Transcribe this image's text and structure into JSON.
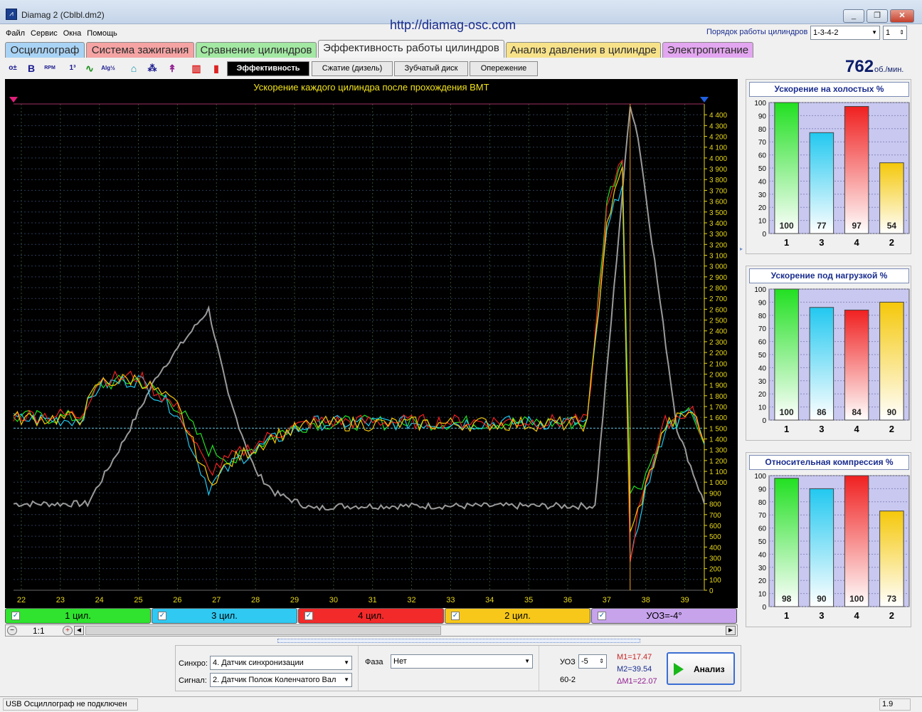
{
  "window": {
    "title": "Diamag 2 (Cblbl.dm2)",
    "url": "http://diamag-osc.com",
    "controls": [
      "_",
      "❐",
      "✕"
    ]
  },
  "menu": [
    "Файл",
    "Сервис",
    "Окна",
    "Помощь"
  ],
  "firing_order": {
    "label": "Порядок работы цилиндров",
    "value": "1-3-4-2",
    "cylinder_value": "1"
  },
  "tabs": [
    {
      "label": "Осциллограф",
      "color": "#a9d3f5"
    },
    {
      "label": "Система зажигания",
      "color": "#f5a3a3"
    },
    {
      "label": "Сравнение цилиндров",
      "color": "#a3e8a3"
    },
    {
      "label": "Эффективность работы цилиндров",
      "color": "#f4f4f4",
      "active": true
    },
    {
      "label": "Анализ давления в цилиндре",
      "color": "#f7e28a"
    },
    {
      "label": "Электропитание",
      "color": "#e3a6f0"
    }
  ],
  "toolbar": {
    "icons": [
      "o±",
      "B",
      "RPM",
      "1³",
      "∿",
      "Alg½",
      "⌂",
      "⁂",
      "↟",
      "▥",
      "▮"
    ],
    "icon_names": [
      "zero-offset-icon",
      "bold-icon",
      "rpm-icon",
      "scale-icon",
      "wave-icon",
      "algorithm-icon",
      "sensor-icon",
      "counter-icon",
      "filter-icon",
      "bars-chart-icon",
      "bar-icon"
    ],
    "subtabs": [
      "Эффективность",
      "Сжатие (дизель)",
      "Зубчатый диск",
      "Опережение"
    ]
  },
  "rpm": {
    "value": "762",
    "unit": "об./мин."
  },
  "scope": {
    "title": "Ускорение каждого цилиндра после прохождения ВМТ",
    "bg_color": "#000000"
  },
  "chart_data": [
    {
      "type": "line",
      "title": "Ускорение каждого цилиндра после прохождения ВМТ",
      "xlabel": "",
      "ylabel": "",
      "xlim": [
        21.8,
        39.5
      ],
      "ylim": [
        0,
        4500
      ],
      "x_ticks": [
        "22",
        "23",
        "24",
        "25",
        "26",
        "27",
        "28",
        "29",
        "30",
        "31",
        "32",
        "33",
        "34",
        "35",
        "36",
        "37",
        "38",
        "39"
      ],
      "y_ticks": [
        "0",
        "100",
        "200",
        "300",
        "400",
        "500",
        "600",
        "700",
        "800",
        "900",
        "1 000",
        "1 100",
        "1 200",
        "1 300",
        "1 400",
        "1 500",
        "1 600",
        "1 700",
        "1 800",
        "1 900",
        "2 000",
        "2 100",
        "2 200",
        "2 300",
        "2 400",
        "2 500",
        "2 600",
        "2 700",
        "2 800",
        "2 900",
        "3 000",
        "3 100",
        "3 200",
        "3 300",
        "3 400",
        "3 500",
        "3 600",
        "3 700",
        "3 800",
        "3 900",
        "4 000",
        "4 100",
        "4 200",
        "4 300",
        "4 400"
      ],
      "series": [
        {
          "name": "1 цил.",
          "color": "#22e022",
          "x": [
            21.8,
            23.5,
            24,
            25,
            26,
            26.8,
            27.5,
            28.5,
            29.5,
            31,
            33,
            35,
            36.5,
            37,
            37.4,
            37.6,
            37.9,
            38.5,
            39.2,
            39.5
          ],
          "y": [
            1600,
            1600,
            1900,
            1950,
            1700,
            1300,
            1200,
            1450,
            1550,
            1550,
            1550,
            1550,
            1550,
            3600,
            4000,
            900,
            1000,
            1500,
            1650,
            1350
          ]
        },
        {
          "name": "3 цил.",
          "color": "#22c8f0",
          "x": [
            21.8,
            23.5,
            24,
            25,
            26,
            26.8,
            27.5,
            28.5,
            29.5,
            31,
            33,
            35,
            36.5,
            37,
            37.4,
            37.6,
            37.9,
            38.5,
            39.2,
            39.5
          ],
          "y": [
            1580,
            1580,
            1900,
            1950,
            1650,
            950,
            1200,
            1400,
            1550,
            1550,
            1550,
            1550,
            1550,
            3300,
            3800,
            200,
            800,
            1500,
            1650,
            1350
          ]
        },
        {
          "name": "4 цил.",
          "color": "#f02020",
          "x": [
            21.8,
            23.5,
            24,
            25,
            26,
            26.8,
            27.5,
            28.5,
            29.5,
            31,
            33,
            35,
            36.5,
            37,
            37.4,
            37.6,
            37.9,
            38.5,
            39.2,
            39.5
          ],
          "y": [
            1620,
            1620,
            1950,
            1980,
            1680,
            1100,
            1250,
            1450,
            1560,
            1560,
            1560,
            1560,
            1560,
            3500,
            4000,
            300,
            900,
            1550,
            1680,
            1380
          ]
        },
        {
          "name": "2 цил.",
          "color": "#f5c80a",
          "x": [
            21.8,
            23.5,
            24,
            25,
            26,
            26.8,
            27.5,
            28.5,
            29.5,
            31,
            33,
            35,
            36.5,
            37,
            37.4,
            37.6,
            37.9,
            38.5,
            39.2,
            39.5
          ],
          "y": [
            1590,
            1590,
            1920,
            1960,
            1700,
            1000,
            1220,
            1430,
            1540,
            1540,
            1540,
            1540,
            1540,
            3400,
            3900,
            500,
            850,
            1520,
            1660,
            1360
          ]
        },
        {
          "name": "RPM",
          "color": "#9a9a9a",
          "x": [
            21.8,
            23.7,
            24.5,
            25.5,
            26.8,
            27.3,
            28,
            28.5,
            29.5,
            30,
            33,
            36.7,
            37.6,
            37.8,
            38.8,
            39.5
          ],
          "y": [
            800,
            800,
            1300,
            2000,
            2600,
            1800,
            1100,
            900,
            750,
            780,
            780,
            780,
            4500,
            4200,
            1500,
            800
          ]
        }
      ]
    },
    {
      "type": "bar",
      "title": "Ускорение на холостых %",
      "categories": [
        "1",
        "3",
        "4",
        "2"
      ],
      "values": [
        100,
        77,
        97,
        54
      ],
      "ylim": [
        0,
        100
      ],
      "y_ticks": [
        "0",
        "10",
        "20",
        "30",
        "40",
        "50",
        "60",
        "70",
        "80",
        "90",
        "100"
      ],
      "colors": [
        "#22e022",
        "#22c8f0",
        "#f02020",
        "#f5c80a"
      ]
    },
    {
      "type": "bar",
      "title": "Ускорение под нагрузкой %",
      "categories": [
        "1",
        "3",
        "4",
        "2"
      ],
      "values": [
        100,
        86,
        84,
        90
      ],
      "ylim": [
        0,
        100
      ],
      "y_ticks": [
        "0",
        "10",
        "20",
        "30",
        "40",
        "50",
        "60",
        "70",
        "80",
        "90",
        "100"
      ],
      "colors": [
        "#22e022",
        "#22c8f0",
        "#f02020",
        "#f5c80a"
      ]
    },
    {
      "type": "bar",
      "title": "Относительная компрессия %",
      "categories": [
        "1",
        "3",
        "4",
        "2"
      ],
      "values": [
        98,
        90,
        100,
        73
      ],
      "ylim": [
        0,
        100
      ],
      "y_ticks": [
        "0",
        "10",
        "20",
        "30",
        "40",
        "50",
        "60",
        "70",
        "80",
        "90",
        "100"
      ],
      "colors": [
        "#22e022",
        "#22c8f0",
        "#f02020",
        "#f5c80a"
      ]
    }
  ],
  "channels": [
    {
      "label": "1 цил.",
      "color": "#2fe32f",
      "check": "✓"
    },
    {
      "label": "3 цил.",
      "color": "#2fc9f2",
      "check": "✓"
    },
    {
      "label": "4 цил.",
      "color": "#f22a2a",
      "check": "✓"
    },
    {
      "label": "2 цил.",
      "color": "#f7c81a",
      "check": "✓"
    },
    {
      "label": "УОЗ=-4°",
      "color": "#c7a3ec",
      "check": "✓"
    }
  ],
  "scroll": {
    "zoom": "1:1",
    "minus": "−",
    "plus": "+",
    "left": "◄",
    "right": "►"
  },
  "controls": {
    "sync_label": "Синхро:",
    "sync_value": "4.  Датчик синхронизации",
    "signal_label": "Сигнал:",
    "signal_value": "2.  Датчик Полож Коленчатого Вал",
    "phase_label": "Фаза",
    "phase_value": "Нет",
    "uoz_label": "УОЗ",
    "uoz_value": "-5",
    "teeth": "60-2",
    "m1": "M1=17.47",
    "m2": "M2=39.54",
    "dm1": "ΔM1=22.07",
    "analyze_label": "Анализ"
  },
  "status": {
    "text": "USB Осциллограф не подключен",
    "version": "1.9"
  }
}
